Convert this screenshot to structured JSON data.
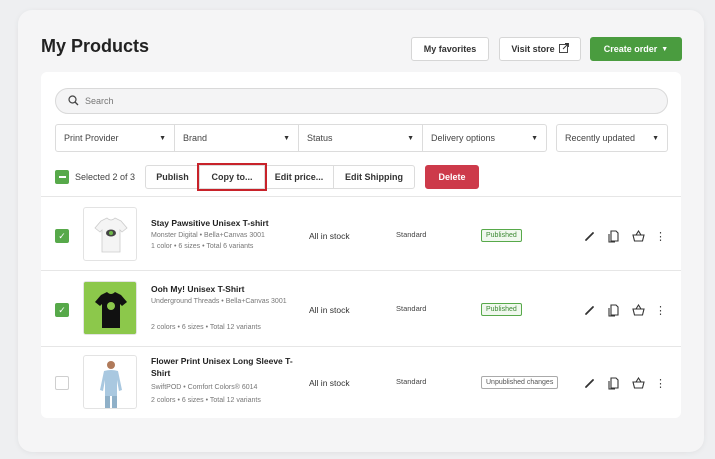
{
  "page": {
    "title": "My Products"
  },
  "header": {
    "favorites_label": "My favorites",
    "visit_store_label": "Visit store",
    "create_order_label": "Create order"
  },
  "search": {
    "placeholder": "Search"
  },
  "filters": [
    {
      "label": "Print Provider"
    },
    {
      "label": "Brand"
    },
    {
      "label": "Status"
    },
    {
      "label": "Delivery options"
    }
  ],
  "sort": {
    "label": "Recently updated"
  },
  "bulk": {
    "selected_label": "Selected 2 of 3",
    "publish_label": "Publish",
    "copy_label": "Copy to...",
    "edit_price_label": "Edit price...",
    "edit_shipping_label": "Edit Shipping",
    "delete_label": "Delete"
  },
  "products": [
    {
      "name": "Stay Pawsitive Unisex T-shirt",
      "provider": "Monster Digital • Bella+Canvas 3001",
      "variants": "1 color • 6 sizes • Total 6 variants",
      "stock": "All in stock",
      "shipping": "Standard",
      "status": "Published",
      "selected": true
    },
    {
      "name": "Ooh My! Unisex T-Shirt",
      "provider": "Underground Threads • Bella+Canvas 3001",
      "variants": "2 colors • 6 sizes • Total 12 variants",
      "stock": "All in stock",
      "shipping": "Standard",
      "status": "Published",
      "selected": true
    },
    {
      "name": "Flower Print Unisex Long Sleeve T-Shirt",
      "provider": "SwiftPOD • Comfort Colors® 6014",
      "variants": "2 colors • 6 sizes • Total 12 variants",
      "stock": "All in stock",
      "shipping": "Standard",
      "status": "Unpublished changes",
      "selected": false
    }
  ],
  "colors": {
    "accent_green": "#4a9c3f",
    "delete_red": "#cd3a4a",
    "highlight_red": "#c8222a"
  },
  "icons": {
    "search": "search-icon",
    "external": "external-link-icon",
    "edit": "pencil-icon",
    "copy": "copy-icon",
    "store": "basket-icon",
    "more": "more-vertical-icon"
  }
}
